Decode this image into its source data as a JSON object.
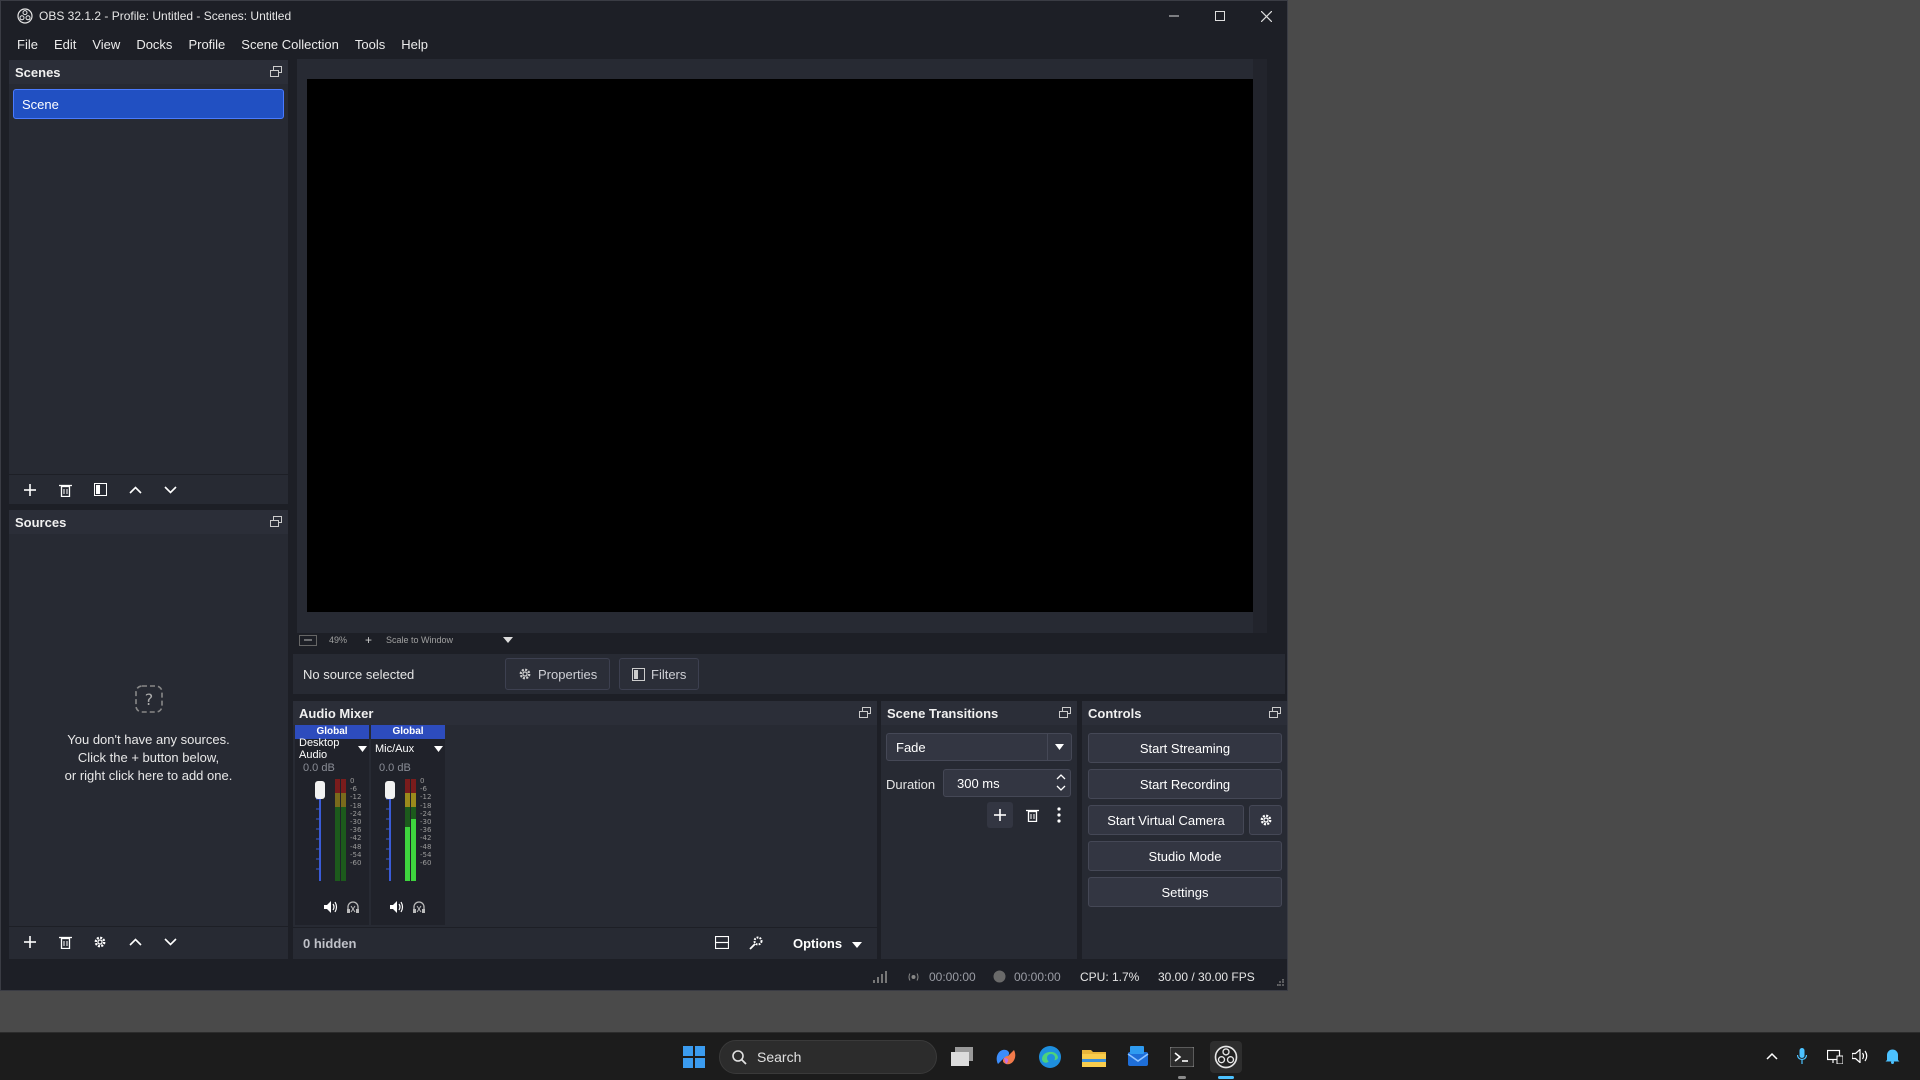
{
  "window": {
    "title": "OBS 32.1.2 - Profile: Untitled - Scenes: Untitled"
  },
  "menu": [
    "File",
    "Edit",
    "View",
    "Docks",
    "Profile",
    "Scene Collection",
    "Tools",
    "Help"
  ],
  "scenes": {
    "title": "Scenes",
    "items": [
      "Scene"
    ]
  },
  "sources": {
    "title": "Sources",
    "empty_line1": "You don't have any sources.",
    "empty_line2": "Click the + button below,",
    "empty_line3": "or right click here to add one."
  },
  "preview": {
    "zoom": "49%",
    "scale_mode": "Scale to Window"
  },
  "context_bar": {
    "status": "No source selected",
    "properties_label": "Properties",
    "filters_label": "Filters"
  },
  "audio_mixer": {
    "title": "Audio Mixer",
    "channels": [
      {
        "global": "Global",
        "name": "Desktop Audio",
        "db": "0.0 dB",
        "level": 0.0
      },
      {
        "global": "Global",
        "name": "Mic/Aux",
        "db": "0.0 dB",
        "level": 0.7
      }
    ],
    "meter_ticks": [
      "0",
      "-6",
      "-12",
      "-18",
      "-24",
      "-30",
      "-36",
      "-42",
      "-48",
      "-54",
      "-60"
    ],
    "hidden_label": "0 hidden",
    "options_label": "Options"
  },
  "transitions": {
    "title": "Scene Transitions",
    "selected": "Fade",
    "duration_label": "Duration",
    "duration_value": "300 ms"
  },
  "controls": {
    "title": "Controls",
    "start_streaming": "Start Streaming",
    "start_recording": "Start Recording",
    "start_virtual_camera": "Start Virtual Camera",
    "studio_mode": "Studio Mode",
    "settings": "Settings"
  },
  "status": {
    "stream_time": "00:00:00",
    "record_time": "00:00:00",
    "cpu": "CPU: 1.7%",
    "fps": "30.00 / 30.00 FPS"
  },
  "taskbar": {
    "search_label": "Search"
  },
  "colors": {
    "accent": "#2150c2",
    "panel": "#272a33",
    "window": "#1d1f26"
  }
}
